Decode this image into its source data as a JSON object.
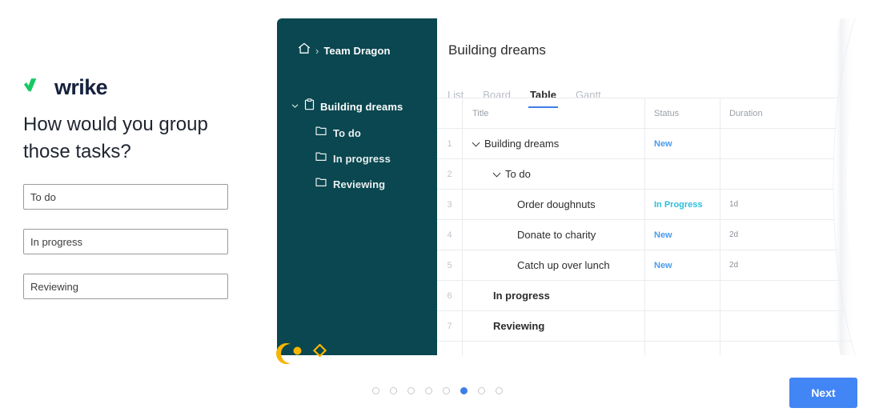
{
  "brand": {
    "logo_text": "wrike",
    "logo_icon": "wrike-check-icon",
    "green": "#17C964",
    "navy": "#16213E"
  },
  "form": {
    "headline": "How would you group those tasks?",
    "fields": [
      {
        "name": "group-field-1",
        "value": "To do",
        "placeholder": "To do"
      },
      {
        "name": "group-field-2",
        "value": "In progress",
        "placeholder": "In progress"
      },
      {
        "name": "group-field-3",
        "value": "Reviewing",
        "placeholder": "Reviewing"
      }
    ]
  },
  "mockup": {
    "sidebar": {
      "bg_color": "#0A4750",
      "breadcrumb": {
        "home_icon": "home-icon",
        "separator": "›",
        "label": "Team Dragon"
      },
      "root": {
        "expand_icon": "chevron-down-icon",
        "project_icon": "clipboard-icon",
        "label": "Building dreams"
      },
      "children": [
        {
          "icon": "folder-icon",
          "label": "To do"
        },
        {
          "icon": "folder-icon",
          "label": "In progress"
        },
        {
          "icon": "folder-icon",
          "label": "Reviewing"
        }
      ]
    },
    "content": {
      "title": "Building dreams",
      "tabs": [
        {
          "label": "List",
          "active": false
        },
        {
          "label": "Board",
          "active": false
        },
        {
          "label": "Table",
          "active": true
        },
        {
          "label": "Gantt",
          "active": false
        }
      ],
      "active_tab_underline_color": "#3D7FE8",
      "table": {
        "columns": [
          "",
          "Title",
          "Status",
          "Duration"
        ],
        "rows": [
          {
            "num": "1",
            "title": "Building dreams",
            "indent": 0,
            "chevron": true,
            "bold": false,
            "status": "New",
            "status_kind": "new",
            "duration": ""
          },
          {
            "num": "2",
            "title": "To do",
            "indent": 1,
            "chevron": true,
            "bold": false,
            "status": "",
            "status_kind": "",
            "duration": ""
          },
          {
            "num": "3",
            "title": "Order doughnuts",
            "indent": 2,
            "chevron": false,
            "bold": false,
            "status": "In Progress",
            "status_kind": "prog",
            "duration": "1d"
          },
          {
            "num": "4",
            "title": "Donate to charity",
            "indent": 2,
            "chevron": false,
            "bold": false,
            "status": "New",
            "status_kind": "new",
            "duration": "2d"
          },
          {
            "num": "5",
            "title": "Catch up over lunch",
            "indent": 2,
            "chevron": false,
            "bold": false,
            "status": "New",
            "status_kind": "new",
            "duration": "2d"
          },
          {
            "num": "6",
            "title": "In progress",
            "indent": 1,
            "chevron": false,
            "bold": true,
            "status": "",
            "status_kind": "",
            "duration": ""
          },
          {
            "num": "7",
            "title": "Reviewing",
            "indent": 1,
            "chevron": false,
            "bold": true,
            "status": "",
            "status_kind": "",
            "duration": ""
          }
        ]
      }
    },
    "decorations": [
      {
        "name": "yellow-arc-shape",
        "color": "#F7B500"
      },
      {
        "name": "yellow-dot-shape",
        "color": "#F7B500"
      },
      {
        "name": "yellow-diamond-shape",
        "color": "#F7B500"
      }
    ]
  },
  "footer": {
    "pagination": {
      "total": 8,
      "active_index": 5,
      "active_color": "#3D7FE8"
    },
    "next_label": "Next",
    "next_color": "#4285F4"
  }
}
